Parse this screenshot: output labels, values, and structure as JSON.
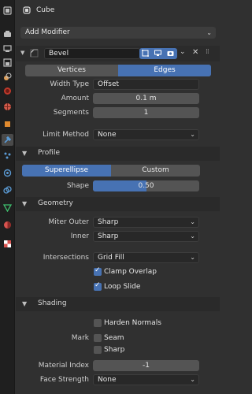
{
  "header": {
    "object_name": "Cube"
  },
  "add_modifier": {
    "label": "Add Modifier"
  },
  "modifier": {
    "name": "Bevel"
  },
  "affect": {
    "options": [
      "Vertices",
      "Edges"
    ],
    "selected": "Edges"
  },
  "width_type": {
    "label": "Width Type",
    "value": "Offset"
  },
  "amount": {
    "label": "Amount",
    "value": "0.1 m"
  },
  "segments": {
    "label": "Segments",
    "value": "1"
  },
  "limit_method": {
    "label": "Limit Method",
    "value": "None"
  },
  "profile": {
    "title": "Profile",
    "options": [
      "Superellipse",
      "Custom"
    ],
    "selected": "Superellipse",
    "shape_label": "Shape",
    "shape_value": "0.50",
    "shape_fraction": 0.5
  },
  "geometry": {
    "title": "Geometry",
    "miter_outer_label": "Miter Outer",
    "miter_outer_value": "Sharp",
    "inner_label": "Inner",
    "inner_value": "Sharp",
    "intersections_label": "Intersections",
    "intersections_value": "Grid Fill",
    "clamp_overlap": {
      "label": "Clamp Overlap",
      "checked": true
    },
    "loop_slide": {
      "label": "Loop Slide",
      "checked": true
    }
  },
  "shading": {
    "title": "Shading",
    "harden_normals": {
      "label": "Harden Normals",
      "checked": false
    },
    "mark_label": "Mark",
    "seam": {
      "label": "Seam",
      "checked": false
    },
    "sharp": {
      "label": "Sharp",
      "checked": false
    },
    "material_index_label": "Material Index",
    "material_index_value": "-1",
    "face_strength_label": "Face Strength",
    "face_strength_value": "None"
  },
  "colors": {
    "accent": "#4772b3",
    "bg": "#303030",
    "field": "#545454"
  },
  "sidebar_icons": [
    "tool-icon",
    "render-icon",
    "output-icon",
    "view-layer-icon",
    "scene-icon",
    "world-icon",
    "object-icon",
    "modifier-icon",
    "particles-icon",
    "physics-icon",
    "constraints-icon",
    "data-icon",
    "material-icon",
    "texture-icon"
  ]
}
